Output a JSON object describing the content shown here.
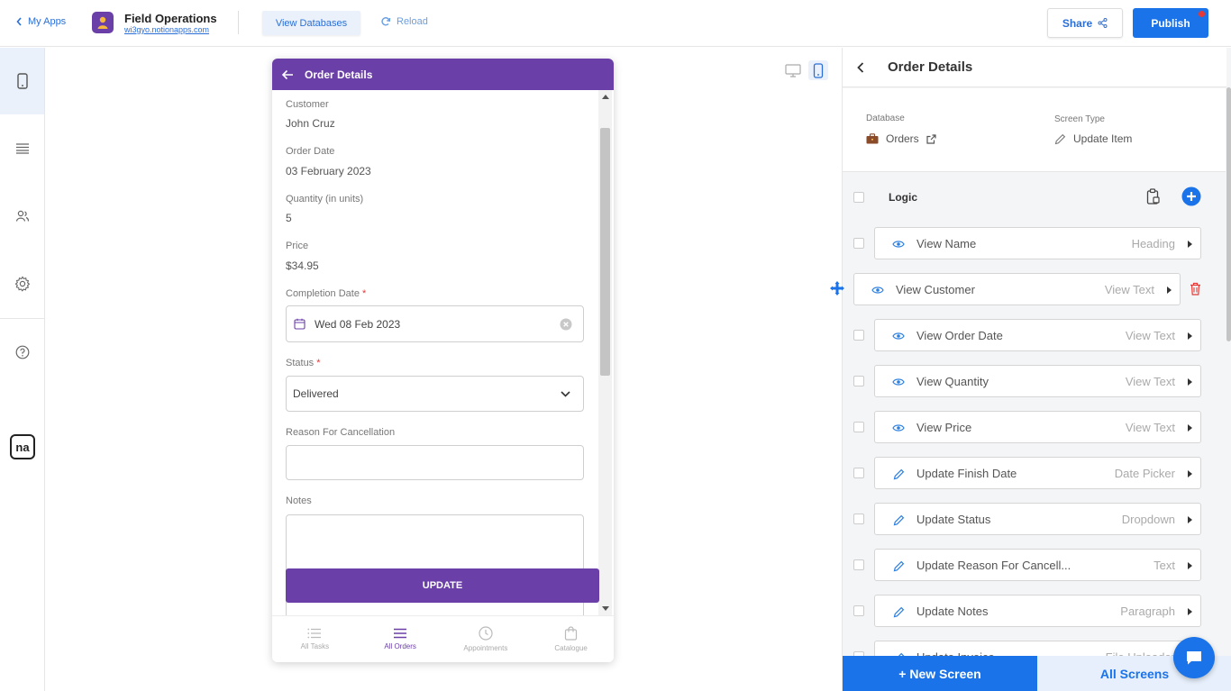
{
  "topbar": {
    "back_label": "My Apps",
    "app_title": "Field Operations",
    "app_url": "wi3gyo.notionapps.com",
    "view_databases": "View Databases",
    "reload": "Reload",
    "share": "Share",
    "publish": "Publish"
  },
  "leftnav": {
    "items": [
      "phone-icon",
      "list-icon",
      "users-icon",
      "gear-icon",
      "help-icon"
    ],
    "logo": "na"
  },
  "phone": {
    "header_title": "Order Details",
    "fields": [
      {
        "label": "Customer",
        "value": "John Cruz"
      },
      {
        "label": "Order Date",
        "value": "03 February 2023"
      },
      {
        "label": "Quantity (in units)",
        "value": "5"
      },
      {
        "label": "Price",
        "value": "$34.95"
      }
    ],
    "completion_label": "Completion Date",
    "completion_value": "Wed 08 Feb 2023",
    "status_label": "Status",
    "status_value": "Delivered",
    "reason_label": "Reason For Cancellation",
    "notes_label": "Notes",
    "required_mark": "*",
    "update_button": "UPDATE",
    "tabs": [
      {
        "label": "All Tasks",
        "icon": "list-icon",
        "active": false
      },
      {
        "label": "All Orders",
        "icon": "menu-icon",
        "active": true
      },
      {
        "label": "Appointments",
        "icon": "clock-icon",
        "active": false
      },
      {
        "label": "Catalogue",
        "icon": "bag-icon",
        "active": false
      }
    ]
  },
  "panel": {
    "title": "Order Details",
    "database_label": "Database",
    "database_value": "Orders",
    "screen_type_label": "Screen Type",
    "screen_type_value": "Update Item",
    "logic_label": "Logic",
    "components": [
      {
        "name": "View Name",
        "type": "Heading",
        "icon": "eye-icon"
      },
      {
        "name": "View Customer",
        "type": "View Text",
        "icon": "eye-icon",
        "selected": true
      },
      {
        "name": "View Order Date",
        "type": "View Text",
        "icon": "eye-icon"
      },
      {
        "name": "View Quantity",
        "type": "View Text",
        "icon": "eye-icon"
      },
      {
        "name": "View Price",
        "type": "View Text",
        "icon": "eye-icon"
      },
      {
        "name": "Update Finish Date",
        "type": "Date Picker",
        "icon": "pencil-icon"
      },
      {
        "name": "Update Status",
        "type": "Dropdown",
        "icon": "pencil-icon"
      },
      {
        "name": "Update Reason For Cancell...",
        "type": "Text",
        "icon": "pencil-icon"
      },
      {
        "name": "Update Notes",
        "type": "Paragraph",
        "icon": "pencil-icon"
      },
      {
        "name": "Update Invoice",
        "type": "File Uploader",
        "icon": "pencil-icon"
      }
    ],
    "new_screen": "+ New Screen",
    "all_screens": "All Screens"
  },
  "colors": {
    "brand_purple": "#6b3fa8",
    "accent_blue": "#1a73e8",
    "danger_red": "#e53935"
  }
}
